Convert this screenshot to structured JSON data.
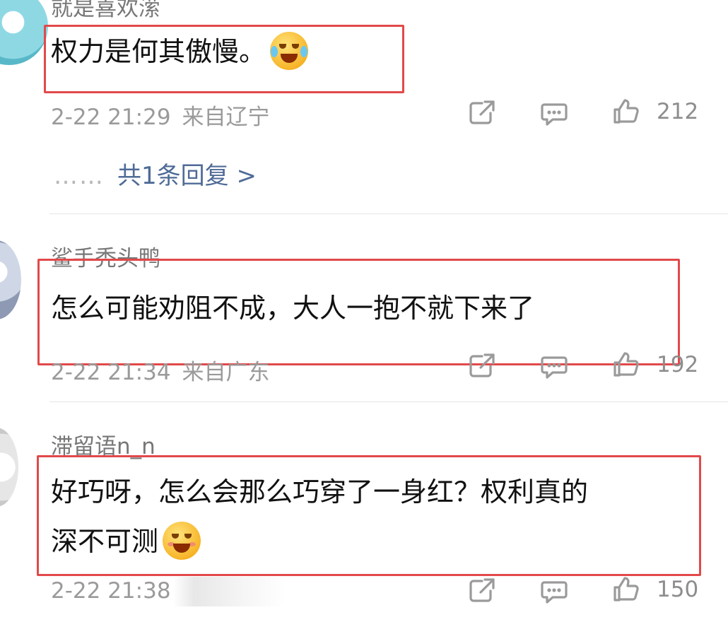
{
  "comments": [
    {
      "username": "就是喜欢潆",
      "content": "权力是何其傲慢。",
      "emoji": "laughing-crying-emoji",
      "time": "2-22 21:29",
      "location": "来自辽宁",
      "likes": "212",
      "reply_link": "共1条回复 >"
    },
    {
      "username": "鲨手秃头鸭",
      "content": "怎么可能劝阻不成，大人一抱不就下来了",
      "time": "2-22 21:34",
      "location": "来自广东",
      "likes": "192"
    },
    {
      "username": "滞留语n_n",
      "content_line1": "好巧呀，怎么会那么巧穿了一身红？权利真的",
      "content_line2": "深不可测",
      "emoji": "blushing-smile-emoji",
      "time": "2-22 21:38",
      "likes": "150"
    }
  ],
  "reply_dots": "……",
  "colors": {
    "highlight": "#e2494a",
    "link": "#4f6b97",
    "meta": "#9a9a9a"
  }
}
